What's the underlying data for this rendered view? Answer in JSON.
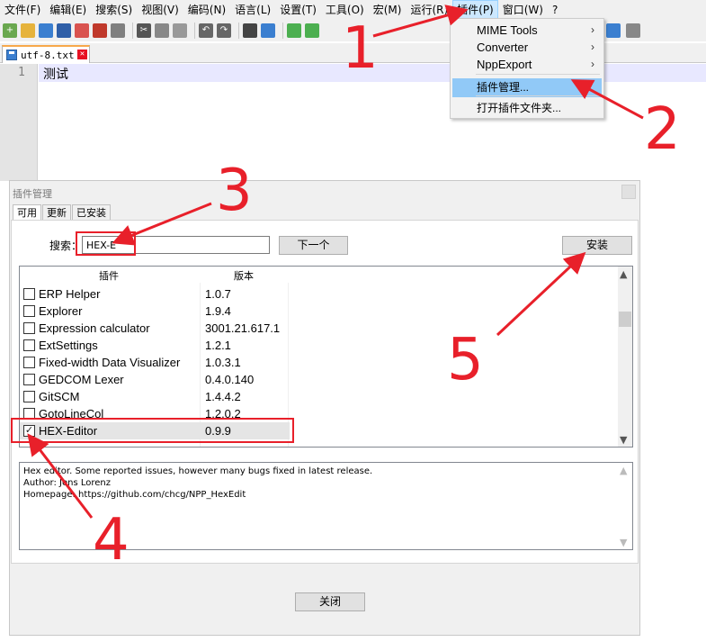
{
  "menubar": {
    "items": [
      "文件(F)",
      "编辑(E)",
      "搜索(S)",
      "视图(V)",
      "编码(N)",
      "语言(L)",
      "设置(T)",
      "工具(O)",
      "宏(M)",
      "运行(R)",
      "插件(P)",
      "窗口(W)",
      "?"
    ]
  },
  "toolbar": {
    "icons": [
      "new-file-icon",
      "open-file-icon",
      "save-icon",
      "save-all-icon",
      "close-icon",
      "close-all-icon",
      "print-icon",
      "cut-icon",
      "copy-icon",
      "paste-icon",
      "undo-icon",
      "redo-icon",
      "find-icon",
      "replace-icon",
      "zoom-in-icon",
      "zoom-out-icon"
    ]
  },
  "tab": {
    "filename": "utf-8.txt",
    "close_glyph": "✕"
  },
  "editor": {
    "line_number": "1",
    "line_text": "测试"
  },
  "plugin_menu": {
    "items": [
      {
        "label": "MIME Tools",
        "arrow": "›"
      },
      {
        "label": "Converter",
        "arrow": "›"
      },
      {
        "label": "NppExport",
        "arrow": "›"
      },
      {
        "label": "插件管理...",
        "arrow": ""
      },
      {
        "label": "打开插件文件夹...",
        "arrow": ""
      }
    ]
  },
  "dialog": {
    "title": "插件管理",
    "tabs": [
      "可用",
      "更新",
      "已安装"
    ],
    "search_label": "搜索：",
    "search_value": "HEX-E",
    "next_button": "下一个",
    "install_button": "安装",
    "close_button": "关闭",
    "columns": {
      "name": "插件",
      "version": "版本"
    },
    "plugins": [
      {
        "name": "ERP Helper",
        "version": "1.0.7",
        "checked": false
      },
      {
        "name": "Explorer",
        "version": "1.9.4",
        "checked": false
      },
      {
        "name": "Expression calculator",
        "version": "3001.21.617.1",
        "checked": false
      },
      {
        "name": "ExtSettings",
        "version": "1.2.1",
        "checked": false
      },
      {
        "name": "Fixed-width Data Visualizer",
        "version": "1.0.3.1",
        "checked": false
      },
      {
        "name": "GEDCOM Lexer",
        "version": "0.4.0.140",
        "checked": false
      },
      {
        "name": "GitSCM",
        "version": "1.4.4.2",
        "checked": false
      },
      {
        "name": "GotoLineCol",
        "version": "1.2.0.2",
        "checked": false
      },
      {
        "name": "HEX-Editor",
        "version": "0.9.9",
        "checked": true
      }
    ],
    "description": [
      "Hex editor. Some reported issues, however many bugs fixed in latest release.",
      "Author: Jens Lorenz",
      "Homepage: https://github.com/chcg/NPP_HexEdit"
    ]
  },
  "annotations": {
    "steps": [
      "1",
      "2",
      "3",
      "4",
      "5"
    ],
    "color": "#e8202a"
  },
  "colors": {
    "menu_highlight": "#91c9f7",
    "tab_accent": "#f7a84b",
    "current_line": "#e8e8ff"
  }
}
